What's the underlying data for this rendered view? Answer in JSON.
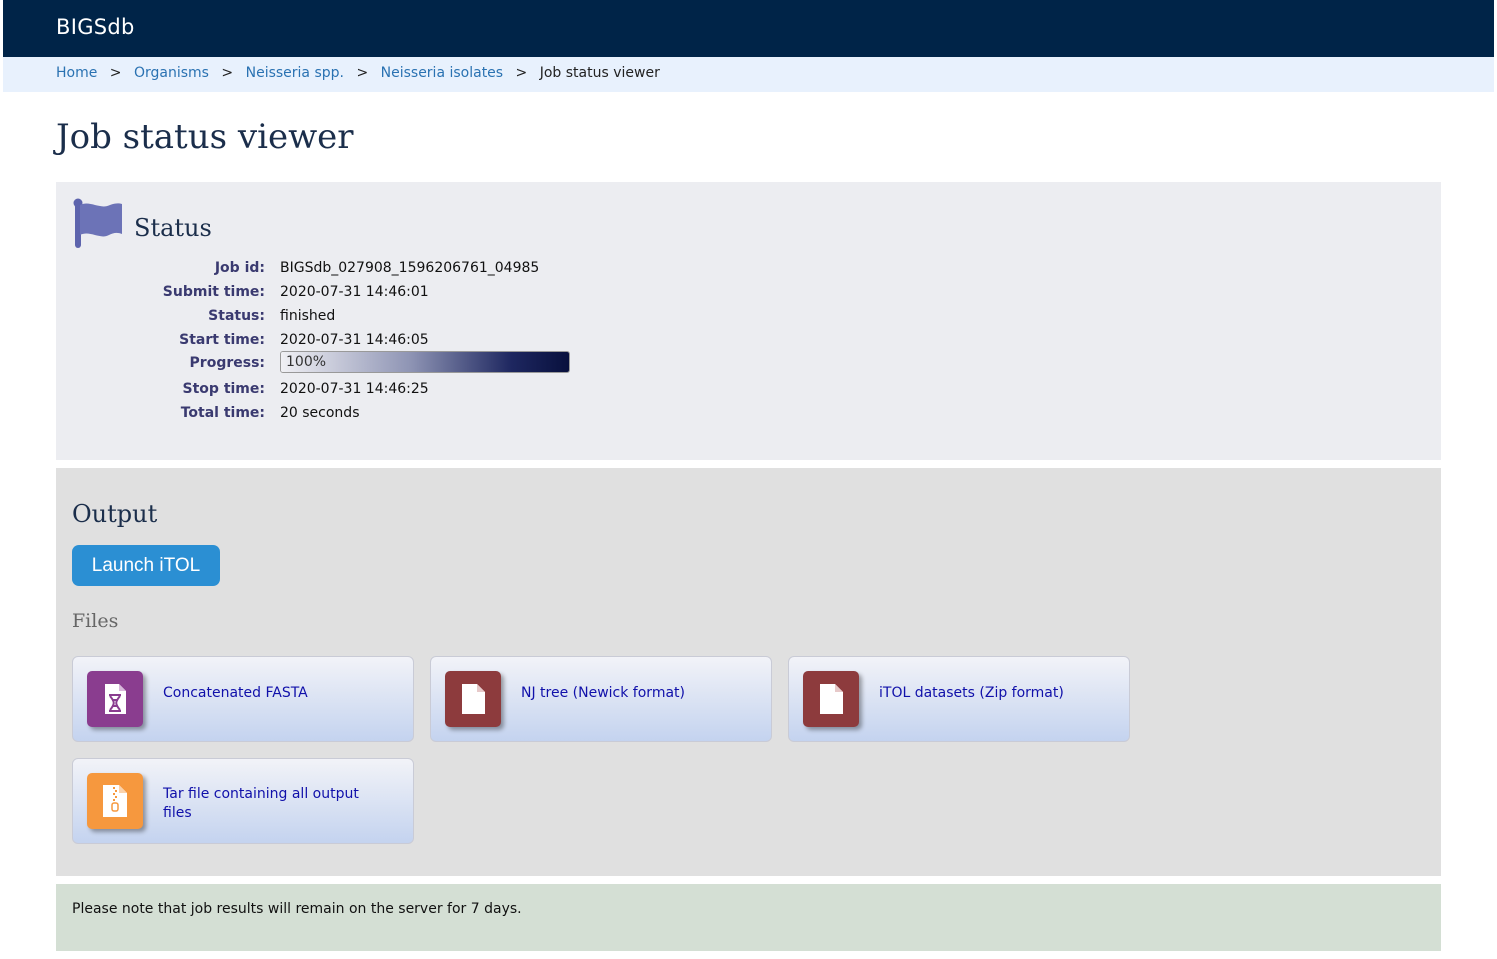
{
  "header": {
    "brand": "BIGSdb"
  },
  "breadcrumb": {
    "items": [
      "Home",
      "Organisms",
      "Neisseria spp.",
      "Neisseria isolates"
    ],
    "current": "Job status viewer",
    "separator": ">"
  },
  "page": {
    "title": "Job status viewer"
  },
  "status": {
    "title": "Status",
    "icon": "flag-icon",
    "fields": {
      "job_id": {
        "label": "Job id:",
        "value": "BIGSdb_027908_1596206761_04985"
      },
      "submit_time": {
        "label": "Submit time:",
        "value": "2020-07-31 14:46:01"
      },
      "status": {
        "label": "Status:",
        "value": "finished"
      },
      "start_time": {
        "label": "Start time:",
        "value": "2020-07-31 14:46:05"
      },
      "progress": {
        "label": "Progress:",
        "value": "100%",
        "percent": 100
      },
      "stop_time": {
        "label": "Stop time:",
        "value": "2020-07-31 14:46:25"
      },
      "total_time": {
        "label": "Total time:",
        "value": "20 seconds"
      }
    }
  },
  "output": {
    "title": "Output",
    "launch_label": "Launch iTOL",
    "files_title": "Files",
    "files": [
      {
        "label": "Concatenated FASTA",
        "icon": "dna-file-icon",
        "color": "#8a3d8f"
      },
      {
        "label": "NJ tree (Newick format)",
        "icon": "file-icon",
        "color": "#8d3b3d"
      },
      {
        "label": "iTOL datasets (Zip format)",
        "icon": "file-icon",
        "color": "#8d3b3d"
      },
      {
        "label": "Tar file containing all output files",
        "icon": "archive-file-icon",
        "color": "#f6983e"
      }
    ]
  },
  "note": {
    "text": "Please note that job results will remain on the server for 7 days."
  },
  "colors": {
    "header_bg": "#002448",
    "breadcrumb_bg": "#e8f1fd",
    "status_bg": "#ecedf1",
    "output_bg": "#e0e0e0",
    "note_bg": "#d4dfd4",
    "button_bg": "#2b8fd3",
    "link": "#2a72b2"
  }
}
